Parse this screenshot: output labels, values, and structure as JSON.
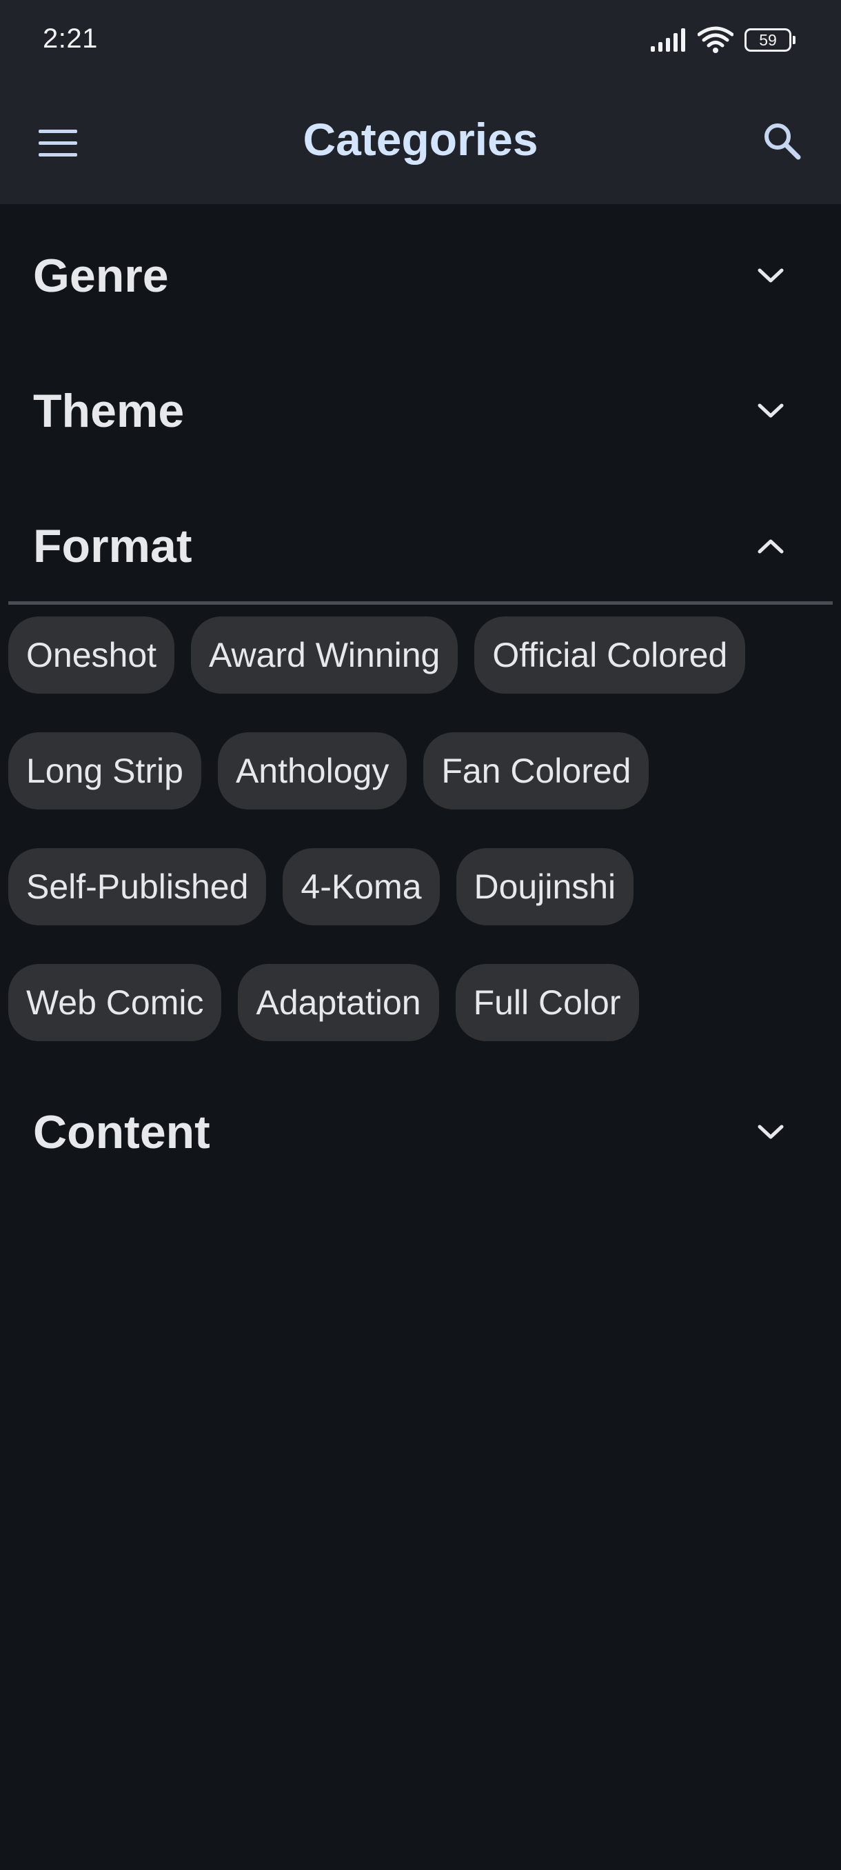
{
  "status": {
    "time": "2:21",
    "battery": "59",
    "icons": [
      "signal-icon",
      "wifi-icon",
      "battery-icon"
    ]
  },
  "appbar": {
    "title": "Categories",
    "menu_icon": "hamburger-menu-icon",
    "search_icon": "search-icon"
  },
  "sections": {
    "genre": {
      "title": "Genre",
      "expanded": false
    },
    "theme": {
      "title": "Theme",
      "expanded": false
    },
    "format": {
      "title": "Format",
      "expanded": true,
      "chips": [
        "Oneshot",
        "Award Winning",
        "Official Colored",
        "Long Strip",
        "Anthology",
        "Fan Colored",
        "Self-Published",
        "4-Koma",
        "Doujinshi",
        "Web Comic",
        "Adaptation",
        "Full Color"
      ]
    },
    "content": {
      "title": "Content",
      "expanded": false
    }
  },
  "colors": {
    "background": "#111419",
    "bar": "#202329",
    "title_accent": "#d3e4ff",
    "chip": "#303236"
  }
}
